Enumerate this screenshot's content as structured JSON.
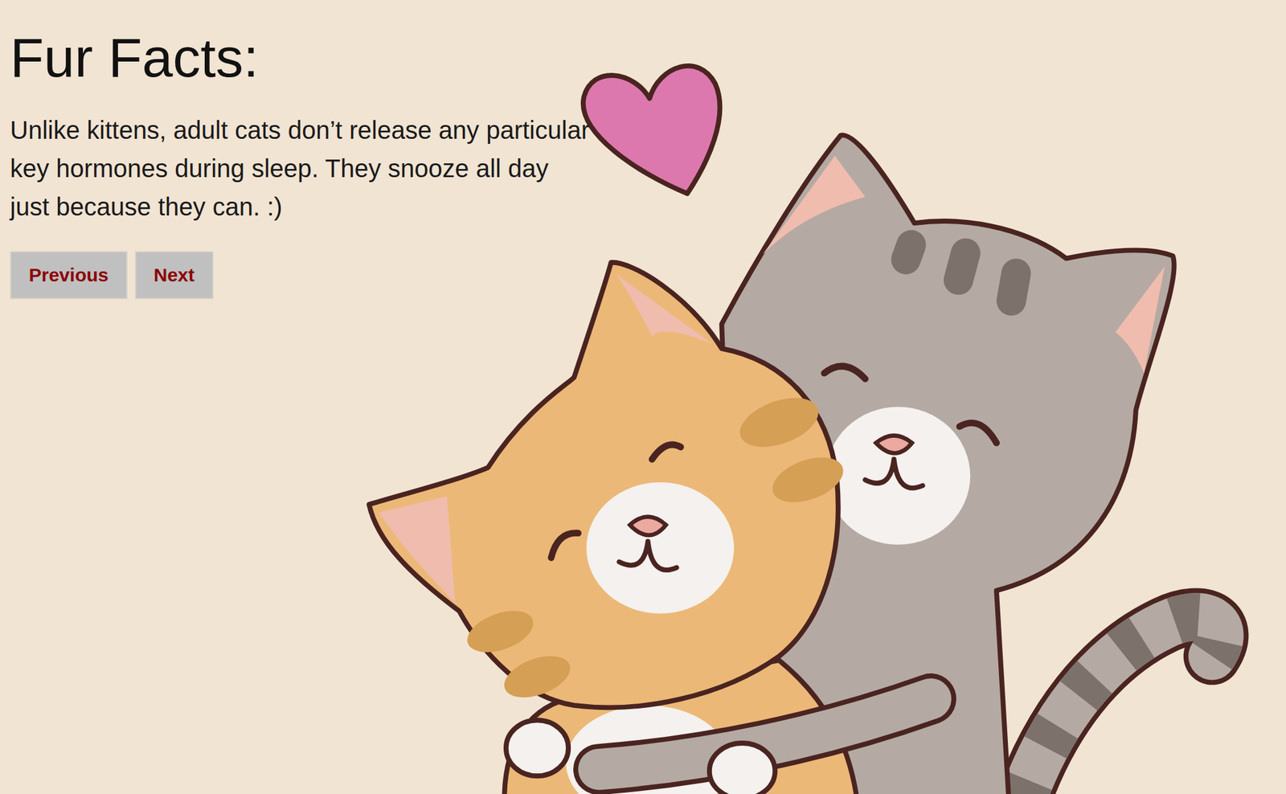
{
  "page": {
    "title": "Fur Facts:",
    "fact": "Unlike kittens, adult cats don’t release any particular key hormones during sleep. They snooze all day just because they can. :)"
  },
  "buttons": [
    "Previous",
    "Next"
  ]
}
